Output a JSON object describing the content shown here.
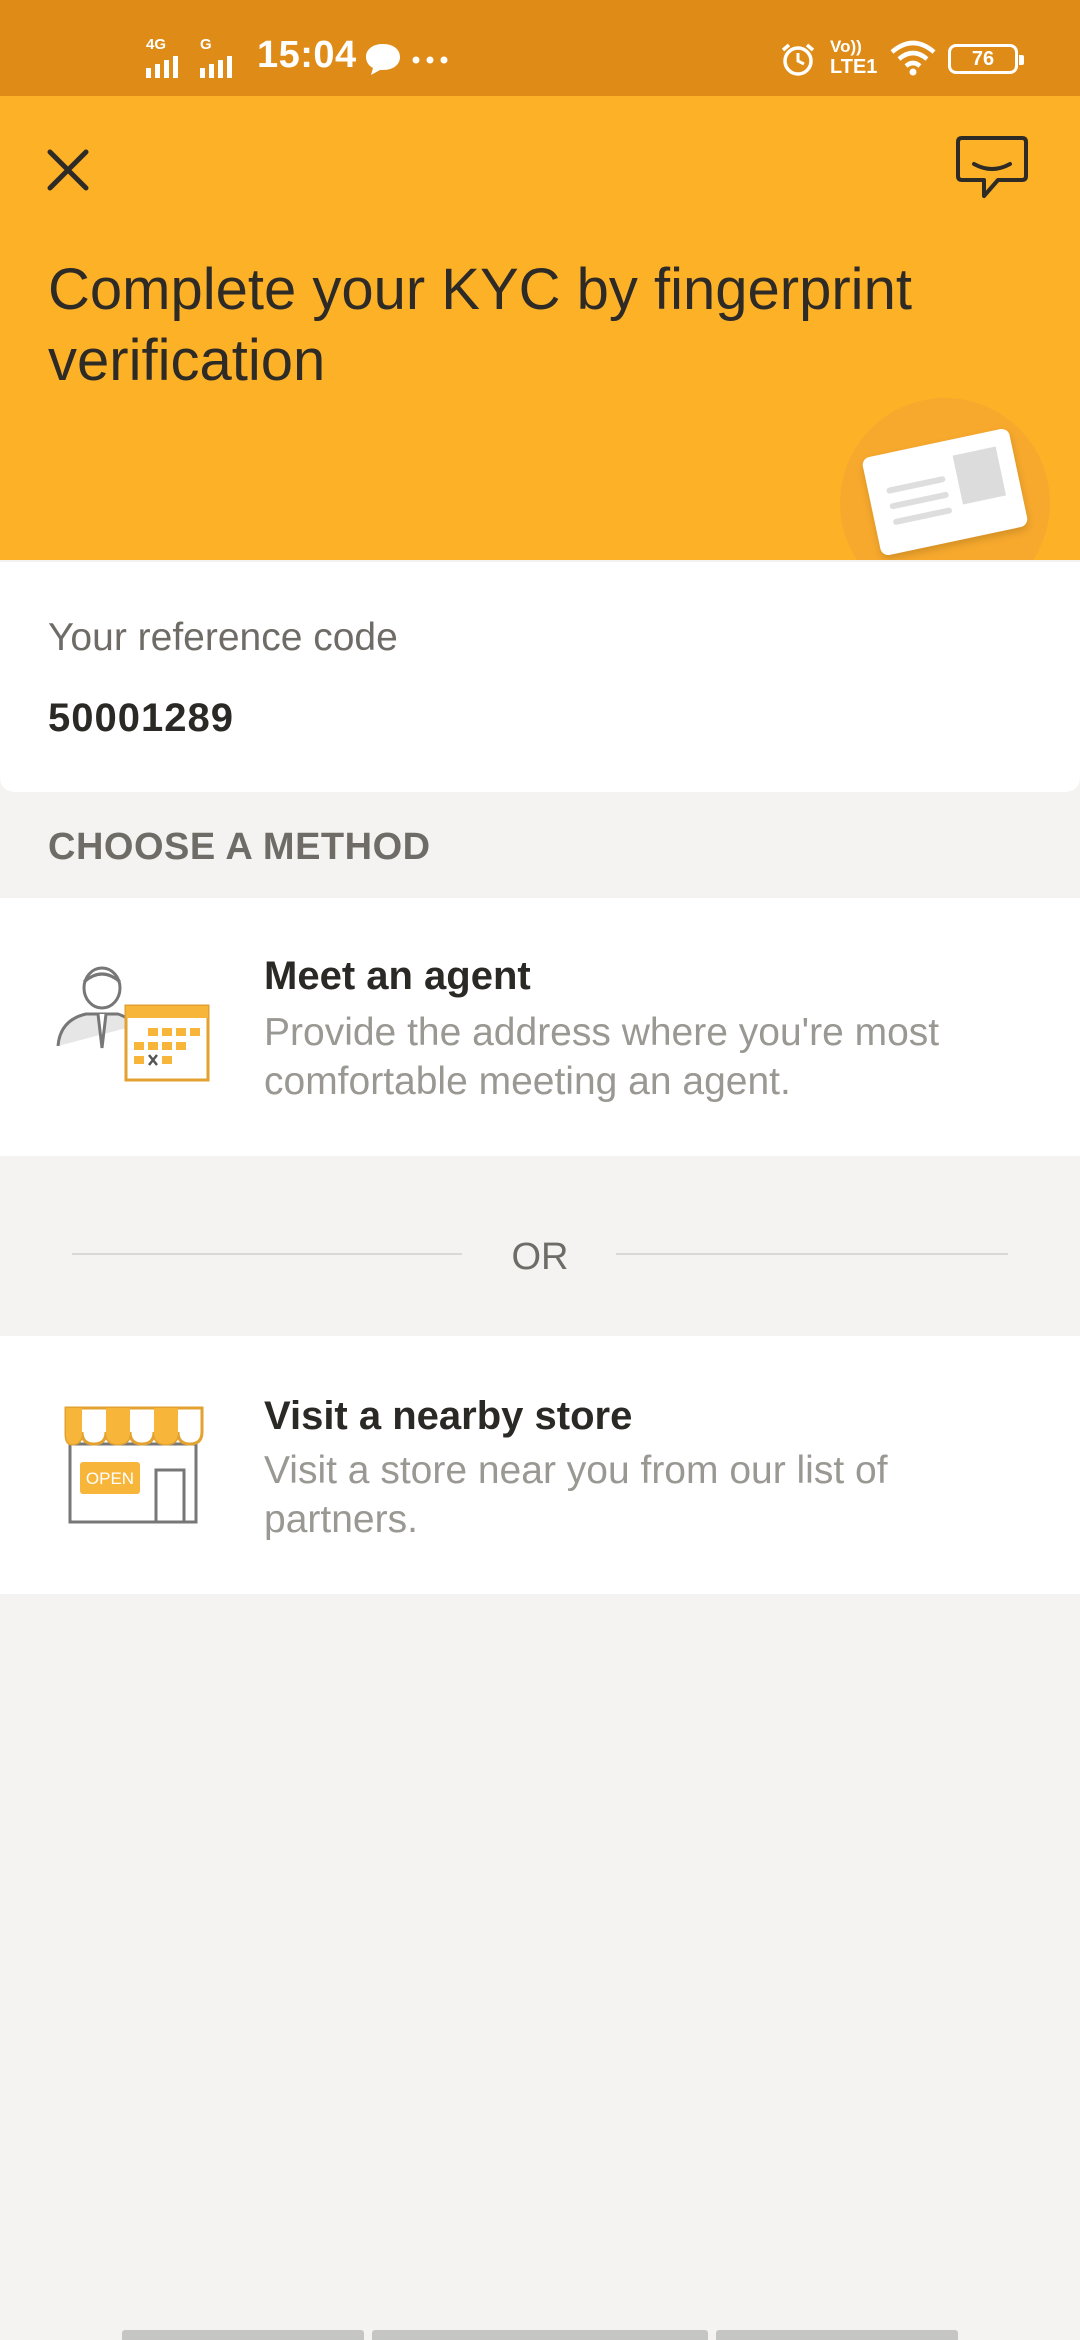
{
  "status_bar": {
    "time": "15:04",
    "sim1_label": "4G",
    "sim2_label": "G",
    "volte_label": "Vo))",
    "lte_label": "LTE1",
    "battery": "76",
    "icons": [
      "signal-bars-icon",
      "chat-bubble-notification-icon",
      "more-dots-icon",
      "alarm-icon",
      "wifi-icon",
      "battery-icon"
    ]
  },
  "header": {
    "title": "Complete your KYC by fingerprint verification",
    "background_color": "#fdb127"
  },
  "reference": {
    "label": "Your reference code",
    "code": "50001289"
  },
  "methods": {
    "section_title": "CHOOSE A METHOD",
    "options": [
      {
        "title": "Meet an agent",
        "description": "Provide the address where you're most comfortable meeting an agent.",
        "icon": "agent-calendar-icon"
      },
      {
        "title": "Visit a nearby store",
        "description": "Visit a store near you from our list of partners.",
        "icon": "store-icon",
        "sign_text": "OPEN"
      }
    ],
    "separator": "OR"
  },
  "colors": {
    "status_bar": "#df8b17",
    "accent": "#fdb127",
    "page_background": "#f4f3f1"
  }
}
